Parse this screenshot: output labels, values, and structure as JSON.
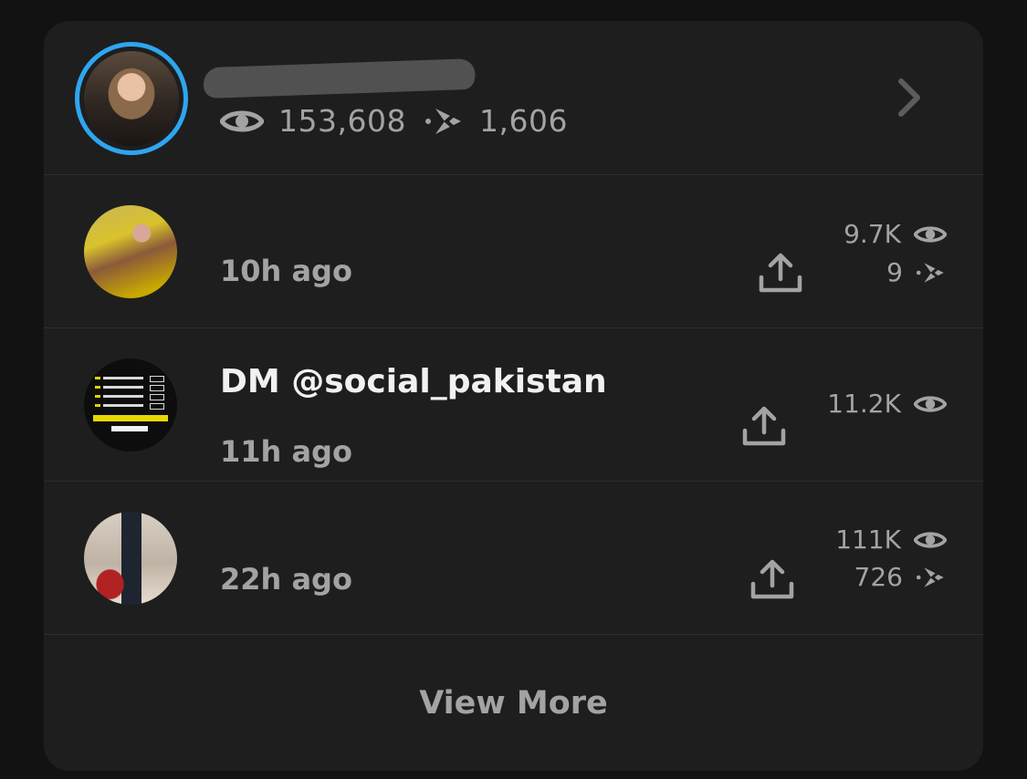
{
  "profile": {
    "views": "153,608",
    "screenshots": "1,606"
  },
  "stories": [
    {
      "title": "",
      "time": "10h ago",
      "views": "9.7K",
      "screenshots": "9"
    },
    {
      "title": "DM @social_pakistan",
      "time": "11h ago",
      "views": "11.2K"
    },
    {
      "title": "",
      "time": "22h ago",
      "views": "111K",
      "screenshots": "726"
    }
  ],
  "footer": {
    "view_more": "View More"
  },
  "icons": {
    "views": "eye-icon",
    "screenshots": "screenshot-arrows-icon",
    "share": "upload-share-icon",
    "chevron": "chevron-right-icon"
  },
  "colors": {
    "background": "#121212",
    "card": "#1e1e1e",
    "ring": "#2ea6f0",
    "text_primary": "#f1f1f1",
    "text_secondary": "#a3a3a3"
  }
}
